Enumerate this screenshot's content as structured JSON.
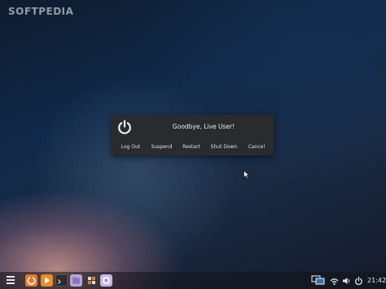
{
  "watermark": "SOFTPEDIA",
  "dialog": {
    "icon": "power-icon",
    "message": "Goodbye, Live User!",
    "buttons": {
      "log_out": "Log Out",
      "suspend": "Suspend",
      "restart": "Restart",
      "shut_down": "Shut Down",
      "cancel": "Cancel"
    }
  },
  "panel": {
    "menu_icon": "hamburger-menu-icon",
    "taskbar_icons": [
      "firefox-icon",
      "media-player-icon",
      "terminal-icon",
      "files-icon",
      "system-monitor-icon",
      "software-store-icon"
    ],
    "tray_icons": [
      "network-icon",
      "wifi-icon",
      "volume-icon",
      "power-settings-icon"
    ],
    "clock": "21:42"
  },
  "colors": {
    "dialog_bg": "#2a2b2e",
    "panel_bg": "#12141a",
    "firefox": "#e9772b",
    "media": "#f08a24",
    "terminal": "#2b2b2b",
    "files": "#b8a5d8",
    "monitor": "#3a3a3a",
    "store": "#c9b4ea"
  }
}
